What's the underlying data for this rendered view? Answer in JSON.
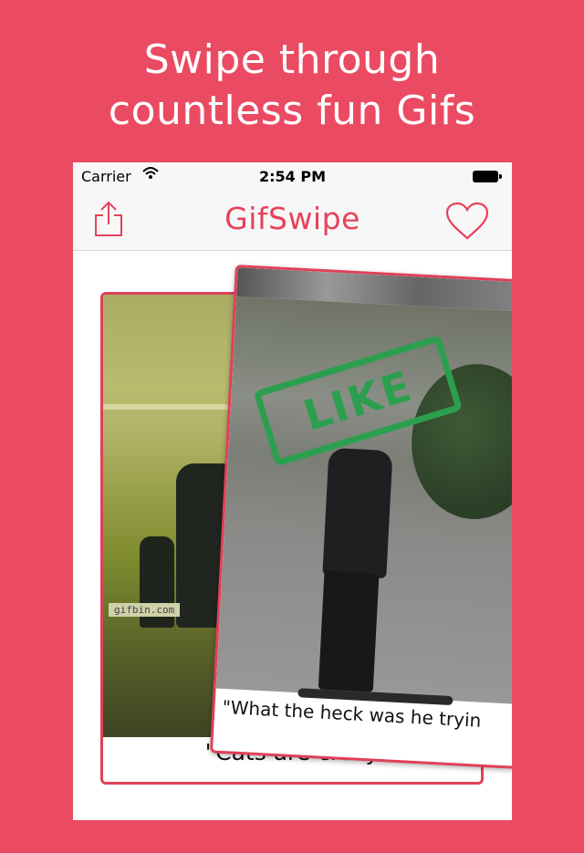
{
  "promo": {
    "line1": "Swipe through",
    "line2": "countless fun Gifs"
  },
  "status_bar": {
    "carrier": "Carrier",
    "time": "2:54 PM",
    "wifi_icon": "wifi-icon",
    "battery_icon": "battery-icon"
  },
  "nav_bar": {
    "title": "GifSwipe",
    "share_icon": "share-icon",
    "heart_icon": "heart-icon",
    "accent_color": "#e8415b"
  },
  "cards": {
    "back": {
      "caption": "\"Cats are crazy",
      "watermark": "gifbin.com"
    },
    "front": {
      "caption": "\"What the heck was he tryin",
      "stamp": "LIKE",
      "stamp_color": "#2c9f4f"
    }
  },
  "colors": {
    "background": "#ea4b63",
    "card_border": "#e0405a"
  }
}
